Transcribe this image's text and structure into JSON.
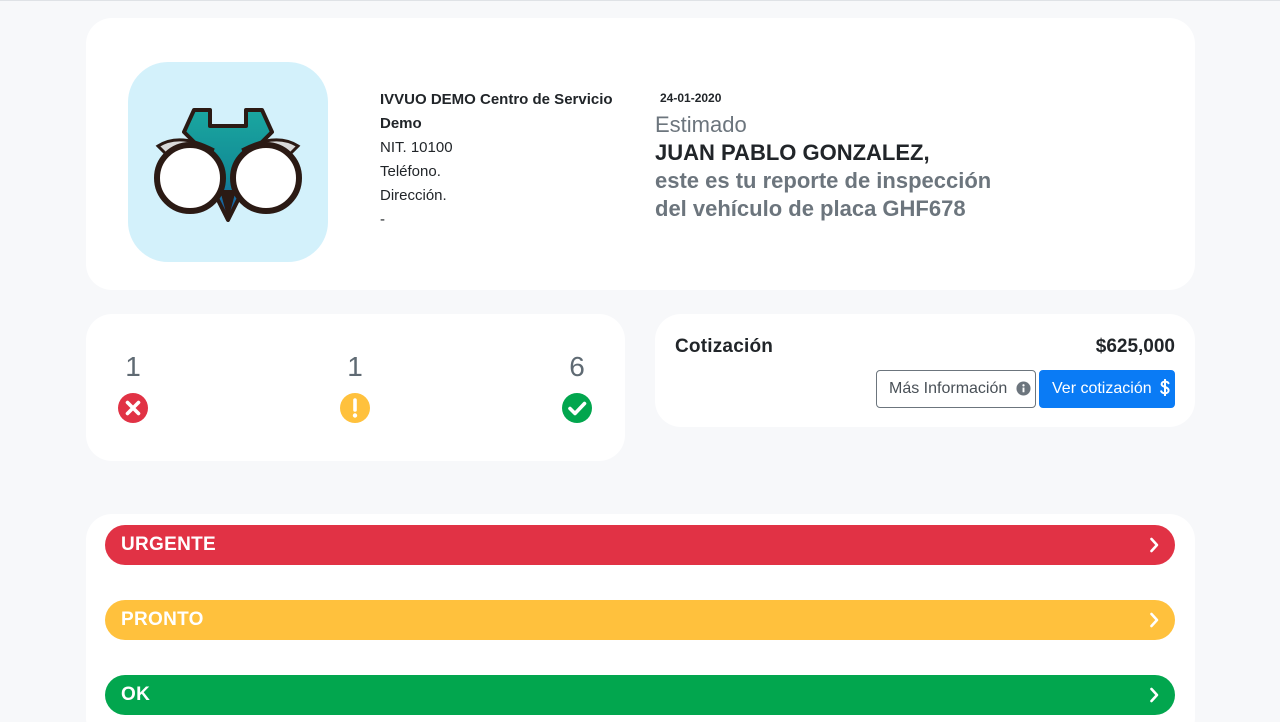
{
  "header": {
    "company_name": "IVVUO DEMO Centro de Servicio Demo",
    "nit": "NIT. 10100",
    "phone": "Teléfono.",
    "address": "Dirección.",
    "extra": "-",
    "date": "24-01-2020",
    "salutation": "Estimado",
    "customer_name": "JUAN PABLO GONZALEZ,",
    "message_line1": "este es tu reporte de inspección",
    "message_line2": "del vehículo de placa GHF678",
    "logo_icon": "owl-logo-icon"
  },
  "counts": [
    {
      "value": "1",
      "icon": "x-circle-icon",
      "color": "#e13245"
    },
    {
      "value": "1",
      "icon": "exclamation-circle-icon",
      "color": "#ffc13d"
    },
    {
      "value": "6",
      "icon": "check-circle-icon",
      "color": "#02a64e"
    }
  ],
  "quote": {
    "label": "Cotización",
    "amount": "$625,000",
    "more_info_label": "Más Información",
    "view_label": "Ver cotización",
    "accent": "#0a7bf5"
  },
  "status_sections": [
    {
      "label": "URGENTE",
      "color": "#e13245"
    },
    {
      "label": "PRONTO",
      "color": "#ffc13d"
    },
    {
      "label": "OK",
      "color": "#02a64e"
    }
  ]
}
